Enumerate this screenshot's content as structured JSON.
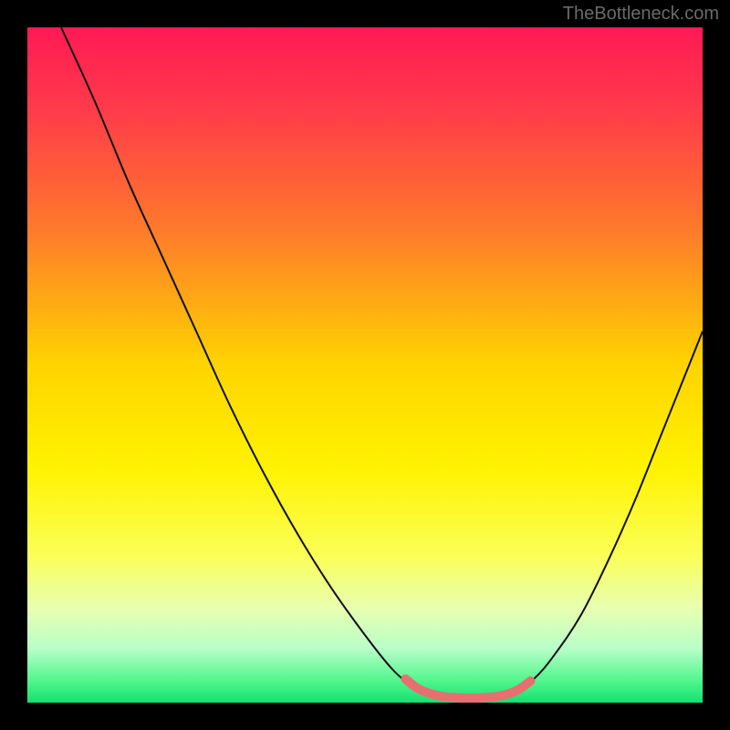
{
  "watermark": "TheBottleneck.com",
  "chart_data": {
    "type": "line",
    "title": "",
    "xlabel": "",
    "ylabel": "",
    "xlim": [
      0,
      100
    ],
    "ylim": [
      0,
      100
    ],
    "background_gradient": {
      "stops": [
        {
          "offset": 0,
          "color": "#ff1a55"
        },
        {
          "offset": 12,
          "color": "#ff3a4a"
        },
        {
          "offset": 30,
          "color": "#ff7a2b"
        },
        {
          "offset": 50,
          "color": "#ffd400"
        },
        {
          "offset": 65,
          "color": "#fff200"
        },
        {
          "offset": 78,
          "color": "#fbff55"
        },
        {
          "offset": 86,
          "color": "#e8ffb0"
        },
        {
          "offset": 92,
          "color": "#b8ffc8"
        },
        {
          "offset": 97,
          "color": "#4cf58a"
        },
        {
          "offset": 100,
          "color": "#15e070"
        }
      ]
    },
    "series": [
      {
        "name": "bottleneck-curve",
        "stroke": "#111111",
        "stroke_width": 2,
        "points": [
          {
            "x": 5,
            "y": 100
          },
          {
            "x": 10,
            "y": 89
          },
          {
            "x": 15,
            "y": 77
          },
          {
            "x": 20,
            "y": 66
          },
          {
            "x": 25,
            "y": 55
          },
          {
            "x": 30,
            "y": 44
          },
          {
            "x": 35,
            "y": 34
          },
          {
            "x": 40,
            "y": 25
          },
          {
            "x": 45,
            "y": 17
          },
          {
            "x": 50,
            "y": 10
          },
          {
            "x": 54,
            "y": 5
          },
          {
            "x": 57,
            "y": 2.5
          },
          {
            "x": 60,
            "y": 1.2
          },
          {
            "x": 63,
            "y": 0.7
          },
          {
            "x": 66,
            "y": 0.6
          },
          {
            "x": 69,
            "y": 0.8
          },
          {
            "x": 72,
            "y": 1.5
          },
          {
            "x": 75,
            "y": 3.5
          },
          {
            "x": 78,
            "y": 7
          },
          {
            "x": 82,
            "y": 13
          },
          {
            "x": 86,
            "y": 21
          },
          {
            "x": 90,
            "y": 30
          },
          {
            "x": 94,
            "y": 40
          },
          {
            "x": 98,
            "y": 50
          },
          {
            "x": 100,
            "y": 55
          }
        ]
      },
      {
        "name": "optimal-range-marker",
        "stroke": "#e76f6f",
        "stroke_width": 10,
        "linecap": "round",
        "points": [
          {
            "x": 56,
            "y": 3.5
          },
          {
            "x": 58,
            "y": 2.0
          },
          {
            "x": 61,
            "y": 1.0
          },
          {
            "x": 64,
            "y": 0.7
          },
          {
            "x": 67,
            "y": 0.7
          },
          {
            "x": 70,
            "y": 1.0
          },
          {
            "x": 72.5,
            "y": 1.8
          },
          {
            "x": 74.5,
            "y": 3.2
          }
        ]
      }
    ]
  }
}
